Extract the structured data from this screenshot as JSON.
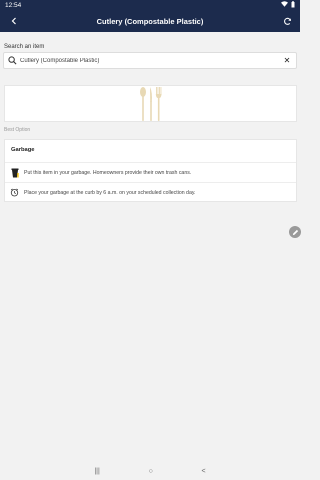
{
  "status_bar": {
    "time": "12:54",
    "wifi_icon": "wifi-icon",
    "battery_icon": "battery-icon"
  },
  "app_bar": {
    "title": "Cutlery (Compostable Plastic)",
    "back_icon": "back-arrow-icon",
    "refresh_icon": "refresh-icon"
  },
  "search": {
    "label": "Search an item",
    "value": "Cutlery (Compostable Plastic)",
    "placeholder": "",
    "clear_glyph": "✕"
  },
  "item_image": {
    "icon": "cutlery-icon"
  },
  "best_option_label": "Best Option",
  "info": {
    "title": "Garbage",
    "rows": [
      {
        "icon": "garbage-bin-icon",
        "text": "Put this item in your garbage. Homeowners provide their own trash cans."
      },
      {
        "icon": "clock-icon",
        "text": "Place your garbage at the curb by 6 a.m. on your scheduled collection day."
      }
    ]
  },
  "fab": {
    "icon": "edit-pencil-icon"
  },
  "nav": {
    "recents": "|||",
    "home": "○",
    "back": "<"
  },
  "colors": {
    "app_bar": "#1c2b4d",
    "background": "#f2f2f2"
  }
}
